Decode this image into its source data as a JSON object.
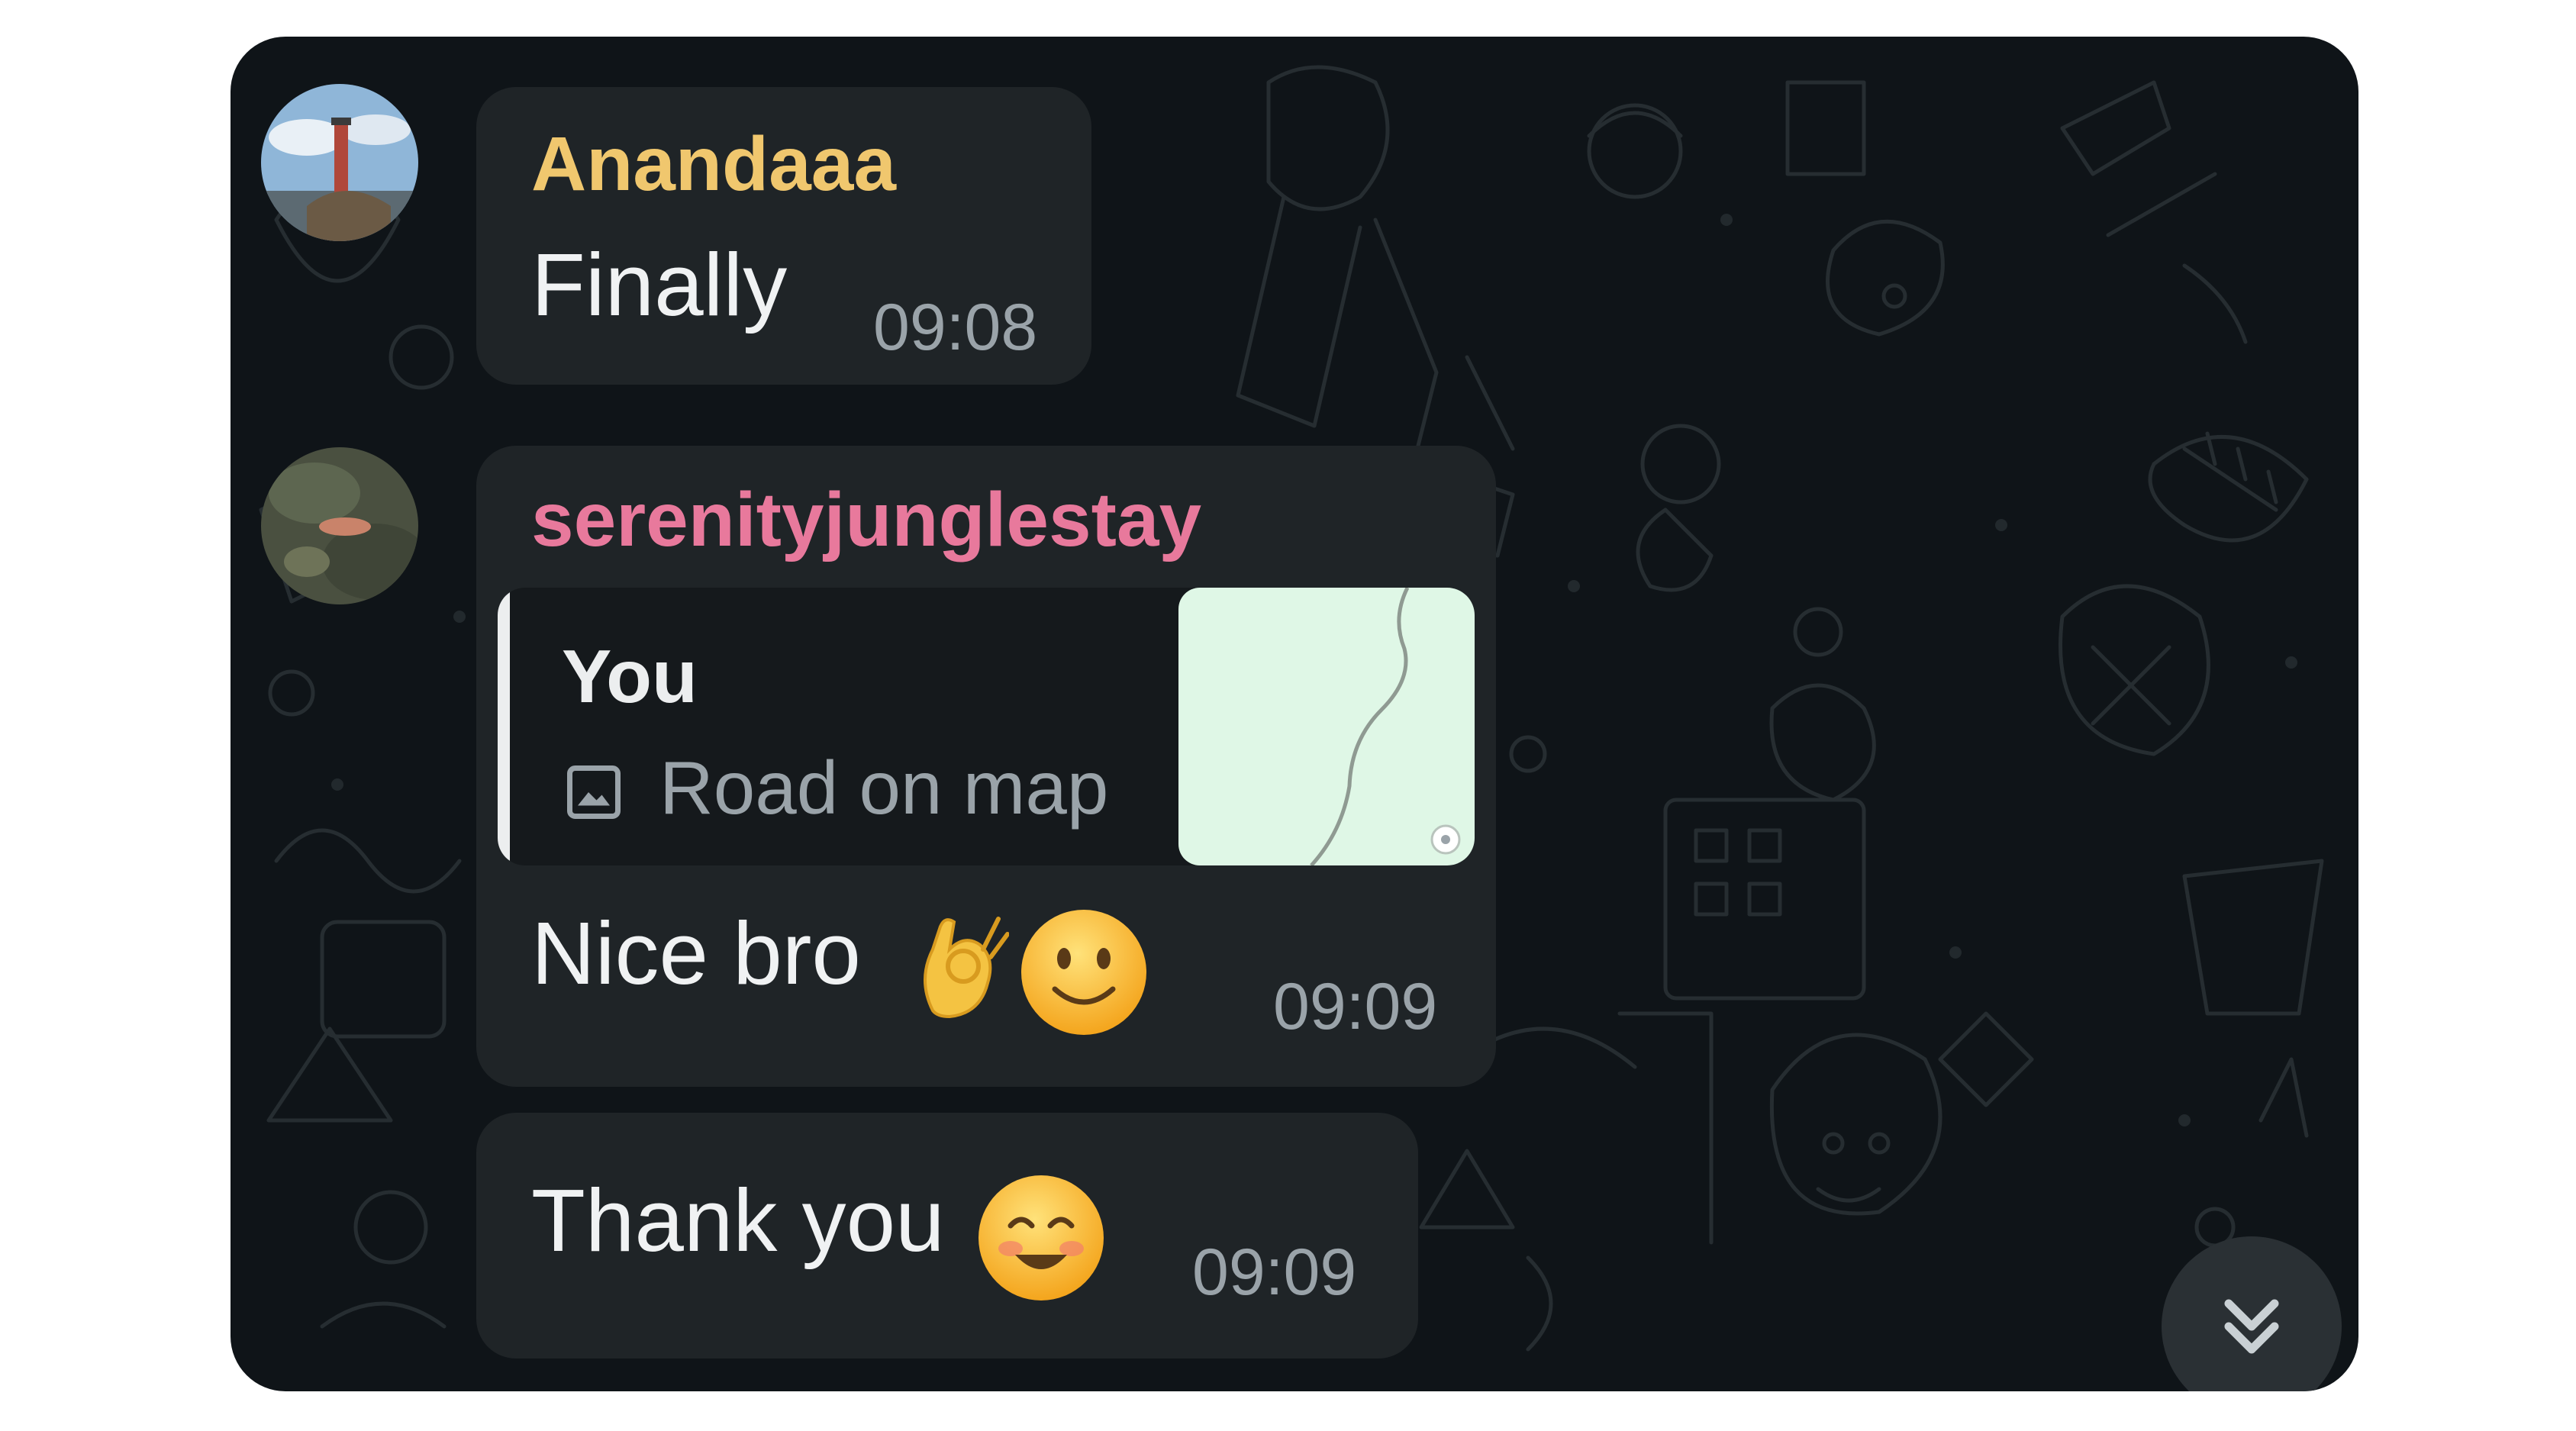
{
  "messages": [
    {
      "sender": "Anandaaa",
      "sender_color": "#f0c76e",
      "text": "Finally",
      "time": "09:08"
    },
    {
      "sender": "serenityjunglestay",
      "sender_color": "#e8799c",
      "reply": {
        "author": "You",
        "preview": "Road on map",
        "preview_icon": "image-icon"
      },
      "text": "Nice bro",
      "emojis": [
        "ok-hand-emoji",
        "slightly-smiling-face-emoji"
      ],
      "time": "09:09"
    },
    {
      "text": "Thank you",
      "emojis": [
        "smiling-face-with-smiling-eyes-emoji"
      ],
      "time": "09:09"
    }
  ],
  "scroll_button": {
    "icon": "double-chevron-down-icon"
  },
  "colors": {
    "background": "#0f1418",
    "bubble": "#1f2427",
    "timestamp": "#9aa3a9",
    "map": "#dff7e6"
  }
}
